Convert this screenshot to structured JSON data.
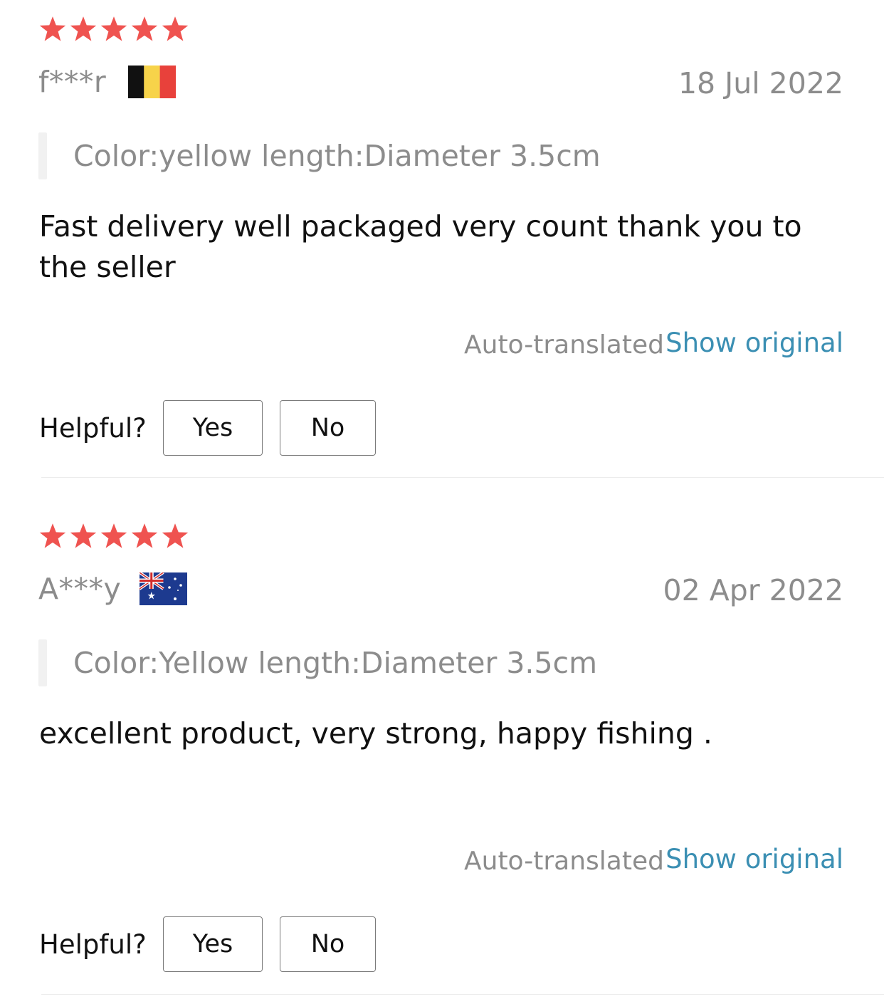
{
  "reviews": [
    {
      "rating": 5,
      "reviewer": "f***r",
      "country_flag": "belgium-flag-icon",
      "date": "18 Jul 2022",
      "sku": "Color:yellow length:Diameter 3.5cm",
      "text": "Fast delivery well packaged very count thank you to the seller",
      "auto_translated_label": "Auto-translated",
      "show_original_label": "Show original",
      "helpful_label": "Helpful?",
      "yes_label": "Yes",
      "no_label": "No"
    },
    {
      "rating": 5,
      "reviewer": "A***y",
      "country_flag": "australia-flag-icon",
      "date": "02 Apr 2022",
      "sku": "Color:Yellow length:Diameter 3.5cm",
      "text": "excellent product, very strong, happy fishing .",
      "auto_translated_label": "Auto-translated",
      "show_original_label": "Show original",
      "helpful_label": "Helpful?",
      "yes_label": "Yes",
      "no_label": "No"
    }
  ],
  "colors": {
    "star": "#ef5350",
    "muted_text": "#8c8c8c",
    "link": "#3b8fb3",
    "body_text": "#111111"
  }
}
